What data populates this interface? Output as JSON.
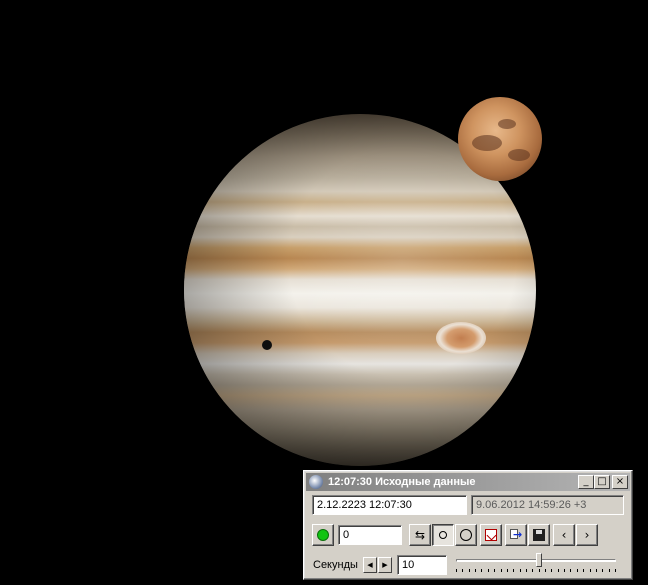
{
  "scene": {
    "planets": [
      "jupiter",
      "mars"
    ],
    "colors": {
      "background": "#000000"
    }
  },
  "window": {
    "title": "12:07:30 Исходные данные",
    "title_buttons": [
      "minimize",
      "maximize",
      "close"
    ]
  },
  "row1": {
    "start_datetime": "2.12.2223  12:07:30",
    "current_datetime": "9.06.2012   14:59:26  +3"
  },
  "row2": {
    "status_icon": "green-dot-icon",
    "counter_value": "0",
    "buttons": [
      "swap-icon",
      "small-circle-icon",
      "big-circle-icon",
      "calendar-icon",
      "export-icon",
      "save-icon",
      "prev-icon",
      "next-icon"
    ],
    "prev_label": "‹",
    "next_label": "›"
  },
  "row3": {
    "seconds_label": "Секунды",
    "seconds_value": "10",
    "slider_level_fraction": 0.52
  },
  "colors": {
    "window_face": "#d4d0c8",
    "titlebar_start": "#808080",
    "status_green": "#11c411"
  }
}
